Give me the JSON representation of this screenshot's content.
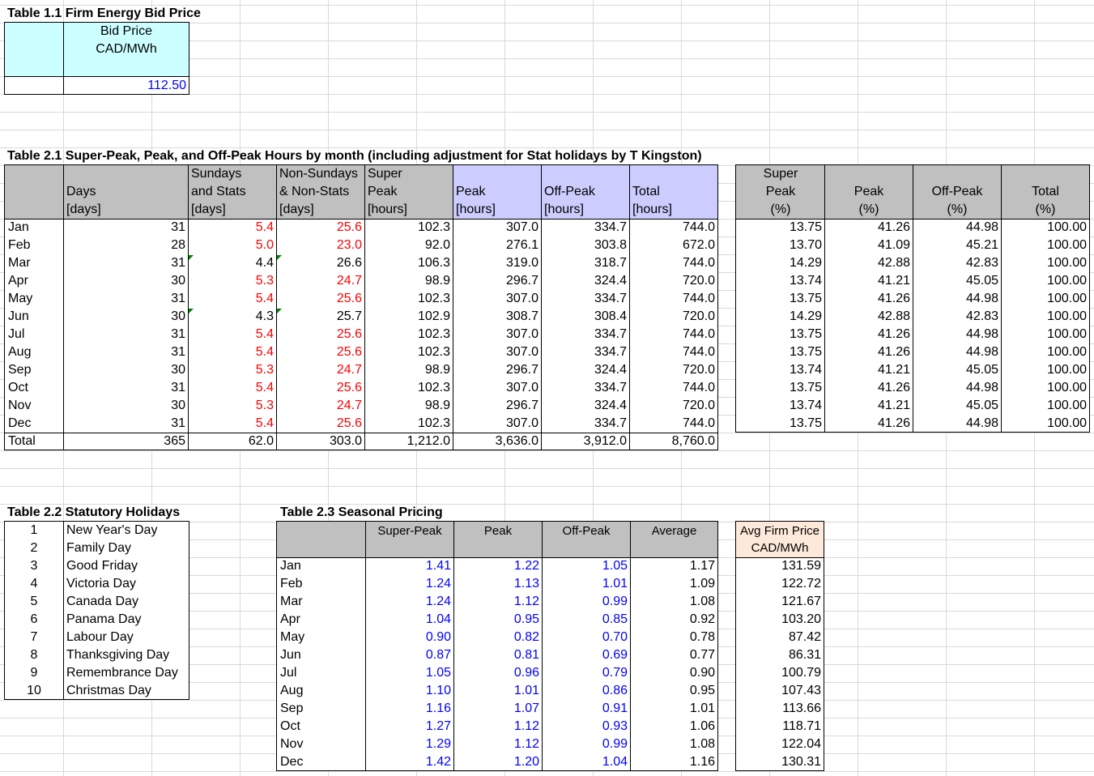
{
  "t11": {
    "title": "Table 1.1 Firm Energy Bid Price",
    "header_l1": "Bid Price",
    "header_l2": "CAD/MWh",
    "value": "112.50"
  },
  "t21": {
    "title": "Table 2.1 Super-Peak, Peak, and Off-Peak Hours by month (including adjustment for Stat holidays by T Kingston)",
    "headers": [
      [
        "",
        "",
        ""
      ],
      [
        "",
        "Days",
        "[days]"
      ],
      [
        "Sundays",
        "and Stats",
        "[days]"
      ],
      [
        "Non-Sundays",
        "& Non-Stats",
        "[days]"
      ],
      [
        "Super",
        "Peak",
        "[hours]"
      ],
      [
        "",
        "Peak",
        "[hours]"
      ],
      [
        "",
        "Off-Peak",
        "[hours]"
      ],
      [
        "",
        "Total",
        "[hours]"
      ]
    ],
    "rows": [
      [
        "Jan",
        "31",
        "5.4",
        "25.6",
        "102.3",
        "307.0",
        "334.7",
        "744.0"
      ],
      [
        "Feb",
        "28",
        "5.0",
        "23.0",
        "92.0",
        "276.1",
        "303.8",
        "672.0"
      ],
      [
        "Mar",
        "31",
        "4.4",
        "26.6",
        "106.3",
        "319.0",
        "318.7",
        "744.0"
      ],
      [
        "Apr",
        "30",
        "5.3",
        "24.7",
        "98.9",
        "296.7",
        "324.4",
        "720.0"
      ],
      [
        "May",
        "31",
        "5.4",
        "25.6",
        "102.3",
        "307.0",
        "334.7",
        "744.0"
      ],
      [
        "Jun",
        "30",
        "4.3",
        "25.7",
        "102.9",
        "308.7",
        "308.4",
        "720.0"
      ],
      [
        "Jul",
        "31",
        "5.4",
        "25.6",
        "102.3",
        "307.0",
        "334.7",
        "744.0"
      ],
      [
        "Aug",
        "31",
        "5.4",
        "25.6",
        "102.3",
        "307.0",
        "334.7",
        "744.0"
      ],
      [
        "Sep",
        "30",
        "5.3",
        "24.7",
        "98.9",
        "296.7",
        "324.4",
        "720.0"
      ],
      [
        "Oct",
        "31",
        "5.4",
        "25.6",
        "102.3",
        "307.0",
        "334.7",
        "744.0"
      ],
      [
        "Nov",
        "30",
        "5.3",
        "24.7",
        "98.9",
        "296.7",
        "324.4",
        "720.0"
      ],
      [
        "Dec",
        "31",
        "5.4",
        "25.6",
        "102.3",
        "307.0",
        "334.7",
        "744.0"
      ]
    ],
    "total": [
      "Total",
      "365",
      "62.0",
      "303.0",
      "1,212.0",
      "3,636.0",
      "3,912.0",
      "8,760.0"
    ]
  },
  "pct": {
    "headers": [
      [
        "Super",
        "Peak",
        "(%)"
      ],
      [
        "",
        "Peak",
        "(%)"
      ],
      [
        "",
        "Off-Peak",
        "(%)"
      ],
      [
        "",
        "Total",
        "(%)"
      ]
    ],
    "rows": [
      [
        "13.75",
        "41.26",
        "44.98",
        "100.00"
      ],
      [
        "13.70",
        "41.09",
        "45.21",
        "100.00"
      ],
      [
        "14.29",
        "42.88",
        "42.83",
        "100.00"
      ],
      [
        "13.74",
        "41.21",
        "45.05",
        "100.00"
      ],
      [
        "13.75",
        "41.26",
        "44.98",
        "100.00"
      ],
      [
        "14.29",
        "42.88",
        "42.83",
        "100.00"
      ],
      [
        "13.75",
        "41.26",
        "44.98",
        "100.00"
      ],
      [
        "13.75",
        "41.26",
        "44.98",
        "100.00"
      ],
      [
        "13.74",
        "41.21",
        "45.05",
        "100.00"
      ],
      [
        "13.75",
        "41.26",
        "44.98",
        "100.00"
      ],
      [
        "13.74",
        "41.21",
        "45.05",
        "100.00"
      ],
      [
        "13.75",
        "41.26",
        "44.98",
        "100.00"
      ]
    ]
  },
  "t22": {
    "title": "Table 2.2 Statutory Holidays",
    "rows": [
      [
        "1",
        "New Year's Day"
      ],
      [
        "2",
        "Family Day"
      ],
      [
        "3",
        "Good Friday"
      ],
      [
        "4",
        "Victoria Day"
      ],
      [
        "5",
        "Canada Day"
      ],
      [
        "6",
        "Panama Day"
      ],
      [
        "7",
        "Labour Day"
      ],
      [
        "8",
        "Thanksgiving Day"
      ],
      [
        "9",
        "Remembrance Day"
      ],
      [
        "10",
        "Christmas Day"
      ]
    ]
  },
  "t23": {
    "title": "Table 2.3 Seasonal Pricing",
    "headers": [
      "",
      "Super-Peak",
      "Peak",
      "Off-Peak",
      "Average"
    ],
    "rows": [
      [
        "Jan",
        "1.41",
        "1.22",
        "1.05",
        "1.17"
      ],
      [
        "Feb",
        "1.24",
        "1.13",
        "1.01",
        "1.09"
      ],
      [
        "Mar",
        "1.24",
        "1.12",
        "0.99",
        "1.08"
      ],
      [
        "Apr",
        "1.04",
        "0.95",
        "0.85",
        "0.92"
      ],
      [
        "May",
        "0.90",
        "0.82",
        "0.70",
        "0.78"
      ],
      [
        "Jun",
        "0.87",
        "0.81",
        "0.69",
        "0.77"
      ],
      [
        "Jul",
        "1.05",
        "0.96",
        "0.79",
        "0.90"
      ],
      [
        "Aug",
        "1.10",
        "1.01",
        "0.86",
        "0.95"
      ],
      [
        "Sep",
        "1.16",
        "1.07",
        "0.91",
        "1.01"
      ],
      [
        "Oct",
        "1.27",
        "1.12",
        "0.93",
        "1.06"
      ],
      [
        "Nov",
        "1.29",
        "1.12",
        "0.99",
        "1.08"
      ],
      [
        "Dec",
        "1.42",
        "1.20",
        "1.04",
        "1.16"
      ]
    ]
  },
  "avg": {
    "header_l1": "Avg Firm Price",
    "header_l2": "CAD/MWh",
    "rows": [
      "131.59",
      "122.72",
      "121.67",
      "103.20",
      "87.42",
      "86.31",
      "100.79",
      "107.43",
      "113.66",
      "118.71",
      "122.04",
      "130.31"
    ]
  },
  "colors": {
    "header_gray": "#c0c0c0",
    "header_purple": "#ccccff",
    "header_cyan": "#ccffff",
    "header_peach": "#fde9d9",
    "input_blue": "#0000ff",
    "override_red": "#ff0000"
  }
}
